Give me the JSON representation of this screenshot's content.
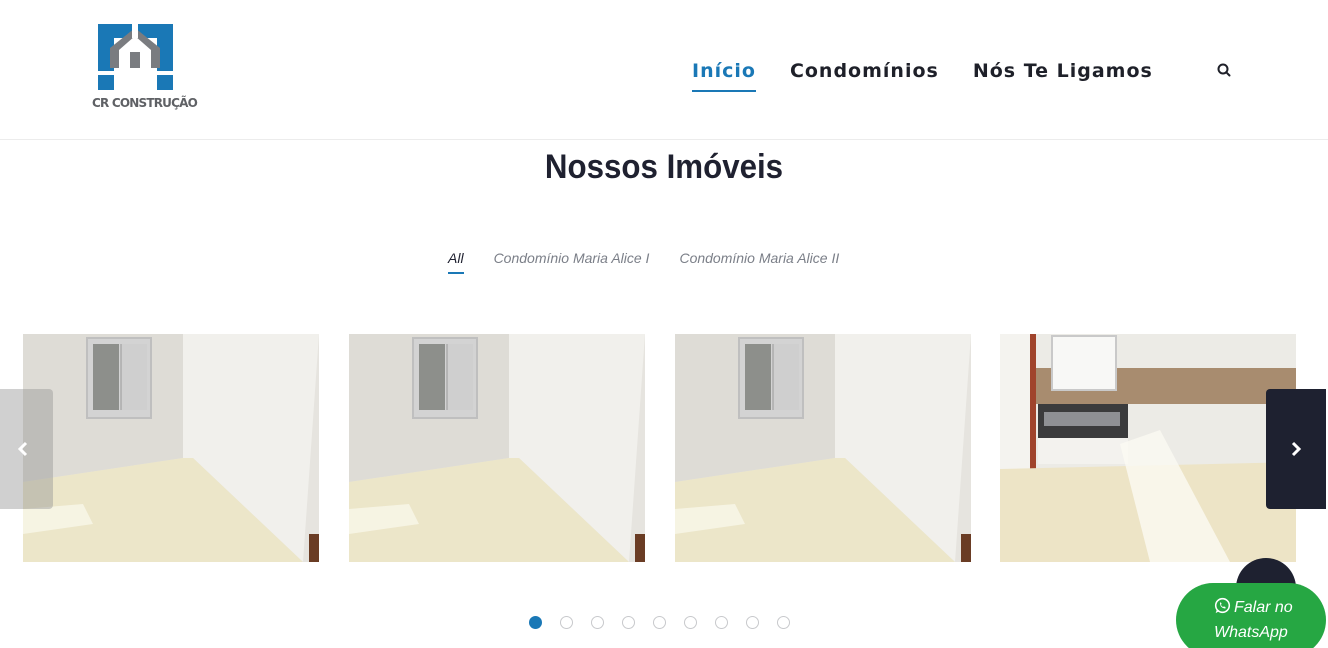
{
  "brand": {
    "name": "CR CONSTRUÇÃO",
    "primary_color": "#1a78b6",
    "dark_color": "#1e2130"
  },
  "nav": {
    "items": [
      {
        "label": "Início",
        "active": true
      },
      {
        "label": "Condomínios",
        "active": false
      },
      {
        "label": "Nós Te Ligamos",
        "active": false
      }
    ],
    "search_icon": "search-icon"
  },
  "section": {
    "title": "Nossos Imóveis",
    "filters": [
      {
        "label": "All",
        "active": true
      },
      {
        "label": "Condomínio Maria Alice I",
        "active": false
      },
      {
        "label": "Condomínio Maria Alice II",
        "active": false
      }
    ]
  },
  "carousel": {
    "slides": [
      {
        "kind": "bedroom"
      },
      {
        "kind": "bedroom"
      },
      {
        "kind": "bedroom"
      },
      {
        "kind": "kitchen"
      }
    ],
    "prev_icon": "chevron-left-icon",
    "next_icon": "chevron-right-icon",
    "dot_count": 9,
    "active_dot": 0
  },
  "whatsapp": {
    "line1": "Falar no",
    "line2": "WhatsApp",
    "icon": "whatsapp-icon",
    "color": "#26a743"
  },
  "back_to_top": {
    "icon": "arrow-up-icon"
  }
}
